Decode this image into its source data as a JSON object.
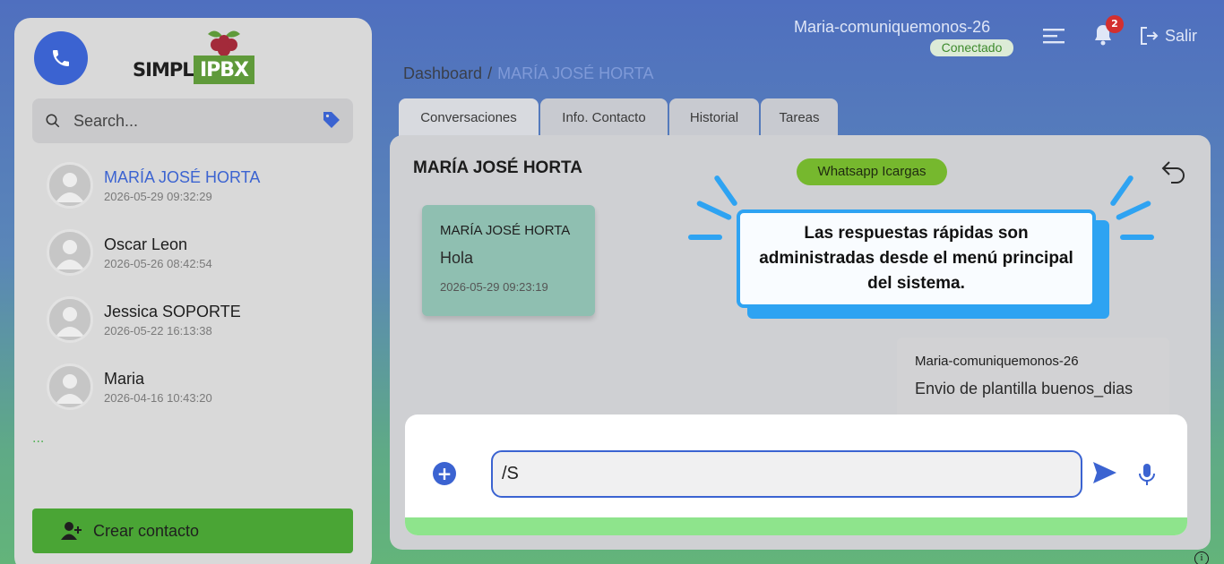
{
  "header": {
    "user": "Maria-comuniquemonos-26",
    "status": "Conectado",
    "notifications_count": "2",
    "logout_label": "Salir"
  },
  "logo": {
    "text_left": "SIMPLE",
    "text_box": "IPBX"
  },
  "breadcrumb": {
    "root": "Dashboard",
    "separator": "/",
    "current": "MARÍA JOSÉ HORTA"
  },
  "sidebar": {
    "search_placeholder": "Search...",
    "contacts": [
      {
        "name": "MARÍA JOSÉ HORTA",
        "date": "2026-05-29 09:32:29"
      },
      {
        "name": "Oscar Leon",
        "date": "2026-05-26 08:42:54"
      },
      {
        "name": "Jessica SOPORTE",
        "date": "2026-05-22 16:13:38"
      },
      {
        "name": "Maria",
        "date": "2026-04-16 10:43:20"
      }
    ],
    "more": "...",
    "create_contact_label": "Crear contacto"
  },
  "tabs": [
    {
      "label": "Conversaciones"
    },
    {
      "label": "Info. Contacto"
    },
    {
      "label": "Historial"
    },
    {
      "label": "Tareas"
    }
  ],
  "conversation": {
    "title": "MARÍA JOSÉ HORTA",
    "channel": "Whatsapp Icargas",
    "messages": [
      {
        "sender": "MARÍA JOSÉ HORTA",
        "text": "Hola",
        "time": "2026-05-29 09:23:19"
      },
      {
        "sender": "Maria-comuniquemonos-26",
        "text": "Envio de plantilla buenos_dias"
      }
    ]
  },
  "callout": {
    "text": "Las respuestas rápidas son administradas desde el menú principal del sistema."
  },
  "composer": {
    "value": "/S"
  },
  "colors": {
    "primary": "#3b63d1",
    "accent_green": "#4aa535",
    "callout_blue": "#2ea3f2"
  }
}
